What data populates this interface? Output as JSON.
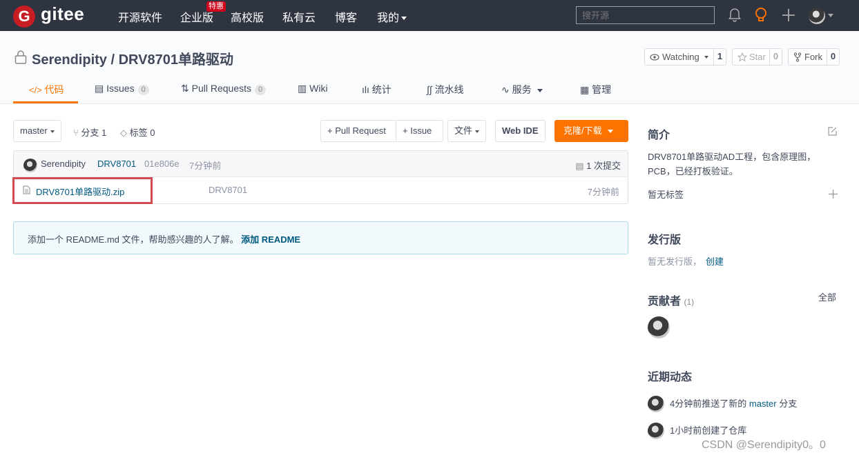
{
  "nav": {
    "logo_letter": "G",
    "logo_text": "gitee",
    "items": [
      "开源软件",
      "企业版",
      "高校版",
      "私有云",
      "博客",
      "我的"
    ],
    "hot_badge": "特惠",
    "search_placeholder": "搜开源"
  },
  "repo": {
    "title": "Serendipity / DRV8701单路驱动",
    "watching_label": "Watching",
    "watching_count": "1",
    "star_label": "Star",
    "star_count": "0",
    "fork_label": "Fork",
    "fork_count": "0"
  },
  "tabs": {
    "code": "代码",
    "issues": "Issues",
    "issues_count": "0",
    "pulls": "Pull Requests",
    "pulls_count": "0",
    "wiki": "Wiki",
    "stats": "统计",
    "pipeline": "流水线",
    "services": "服务",
    "manage": "管理"
  },
  "toolbar": {
    "branch": "master",
    "branches": "分支 1",
    "tags": "标签 0",
    "pull_request": "+ Pull Request",
    "issue": "+ Issue",
    "file": "文件",
    "web_ide": "Web IDE",
    "clone": "克隆/下载"
  },
  "commit": {
    "author": "Serendipity",
    "message": "DRV8701",
    "hash": "01e806e",
    "time": "7分钟前",
    "count": "1 次提交"
  },
  "files": [
    {
      "name": "DRV8701单路驱动.zip",
      "message": "DRV8701",
      "time": "7分钟前"
    }
  ],
  "readme": {
    "text": "添加一个 README.md 文件，帮助感兴趣的人了解。",
    "link": "添加 README"
  },
  "sidebar": {
    "intro_title": "简介",
    "intro_line1": "DRV8701单路驱动AD工程，包含原理图，",
    "intro_line2": "PCB，已经打板验证。",
    "no_tags": "暂无标签",
    "release_title": "发行版",
    "no_release": "暂无发行版，",
    "create": "创建",
    "contrib_title": "贡献者",
    "contrib_count": "(1)",
    "all": "全部",
    "activity_title": "近期动态",
    "act1_pre": "4分钟前推送了新的",
    "act1_branch": "master",
    "act1_post": "分支",
    "act2": "1小时前创建了仓库"
  },
  "watermark": "CSDN @Serendipity0。0"
}
